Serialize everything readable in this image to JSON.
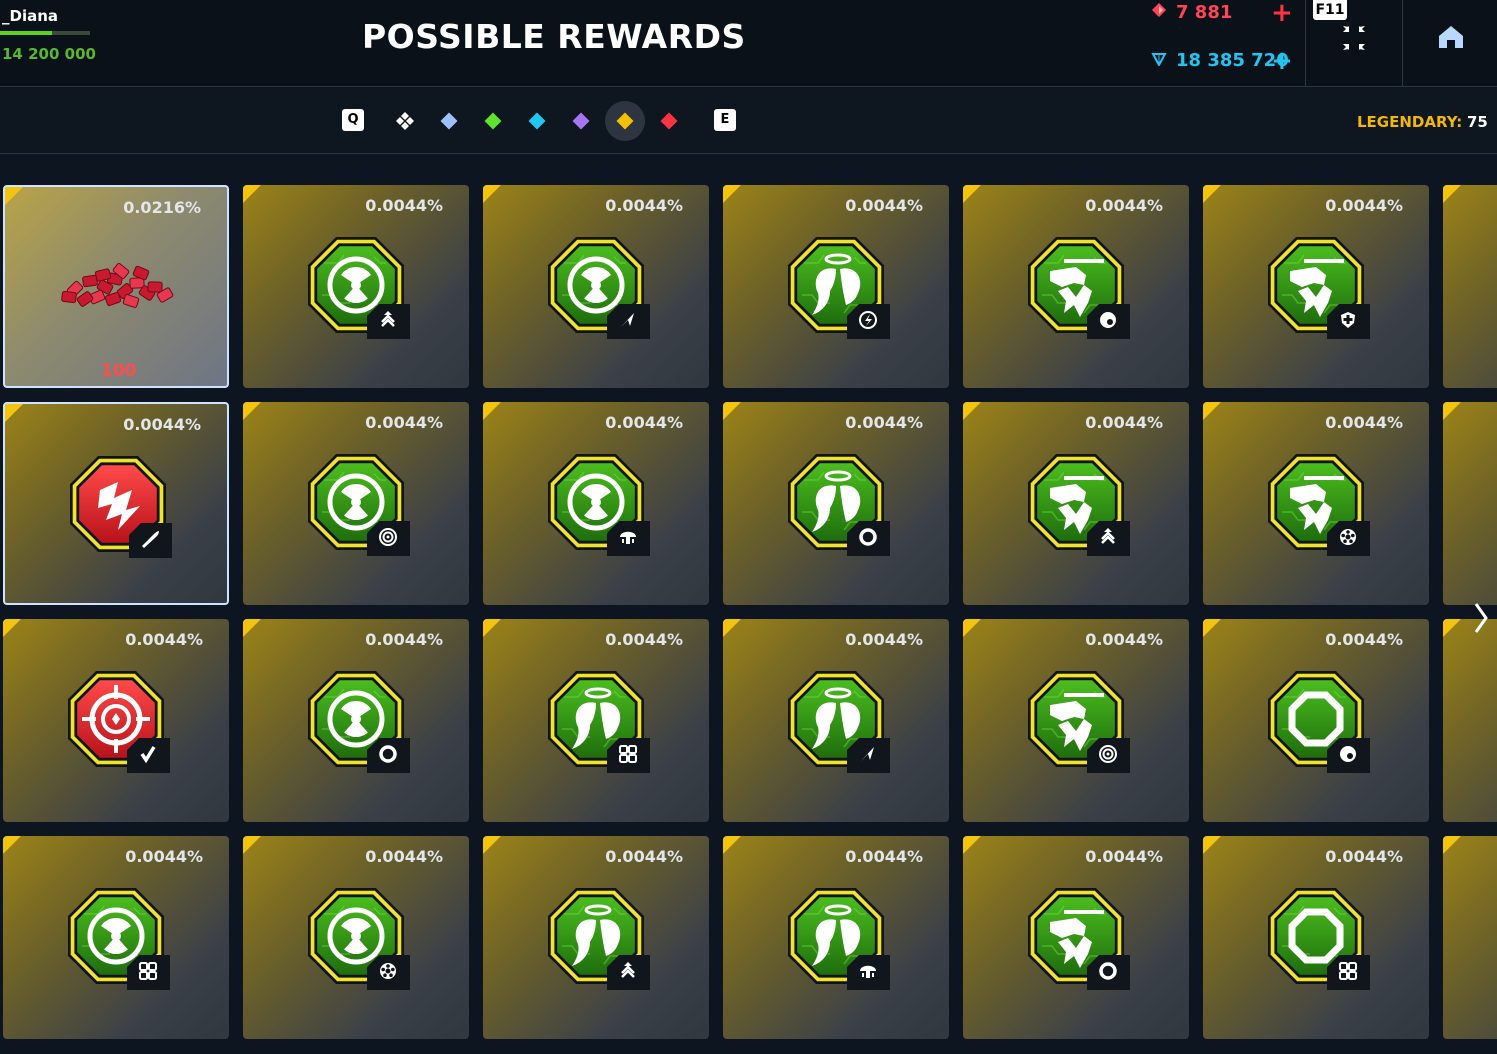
{
  "header": {
    "player_name": "_Diana",
    "player_progress": 0.58,
    "player_score": "14 200 000",
    "title": "POSSIBLE REWARDS",
    "rubies": "7 881",
    "crystals": "18 385 720",
    "fullscreen_key": "F11",
    "add_rubies_icon": "plus-icon",
    "add_crystals_icon": "plus-icon",
    "fullscreen_icon": "collapse-arrows-icon",
    "home_icon": "home-icon"
  },
  "filters": {
    "prev_key": "Q",
    "next_key": "E",
    "rarities": [
      {
        "name": "all",
        "color": "#ffffff",
        "active": false
      },
      {
        "name": "common",
        "color": "#9fc0ff",
        "active": false
      },
      {
        "name": "uncommon",
        "color": "#5ee22a",
        "active": false
      },
      {
        "name": "rare",
        "color": "#1ec8f0",
        "active": false
      },
      {
        "name": "epic",
        "color": "#a576f2",
        "active": false
      },
      {
        "name": "legendary",
        "color": "#f5c000",
        "active": true
      },
      {
        "name": "exotic",
        "color": "#ff3344",
        "active": false
      }
    ],
    "legendary_label": "LEGENDARY:",
    "legendary_count": "75"
  },
  "colors": {
    "legendary_accent": "#f2c40e",
    "ruby_red": "#ff4455",
    "crystal_blue": "#22c4ee",
    "gold": "#f5b800"
  },
  "rewards": [
    [
      {
        "prob": "0.0216%",
        "type": "rubies",
        "qty": "100"
      },
      {
        "prob": "0.0044%",
        "type": "radiation",
        "badge": "rank"
      },
      {
        "prob": "0.0044%",
        "type": "radiation",
        "badge": "dart"
      },
      {
        "prob": "0.0044%",
        "type": "angel",
        "badge": "bolt"
      },
      {
        "prob": "0.0044%",
        "type": "tank",
        "badge": "gear"
      },
      {
        "prob": "0.0044%",
        "type": "tank",
        "badge": "shield"
      }
    ],
    [
      {
        "prob": "0.0044%",
        "type": "red-bolt",
        "badge": "rocket"
      },
      {
        "prob": "0.0044%",
        "type": "radiation",
        "badge": "target"
      },
      {
        "prob": "0.0044%",
        "type": "radiation",
        "badge": "mushroom"
      },
      {
        "prob": "0.0044%",
        "type": "angel",
        "badge": "ring"
      },
      {
        "prob": "0.0044%",
        "type": "tank",
        "badge": "rank"
      },
      {
        "prob": "0.0044%",
        "type": "tank",
        "badge": "wheel"
      }
    ],
    [
      {
        "prob": "0.0044%",
        "type": "red-crosshair",
        "badge": "check"
      },
      {
        "prob": "0.0044%",
        "type": "radiation",
        "badge": "ring"
      },
      {
        "prob": "0.0044%",
        "type": "angel",
        "badge": "grid"
      },
      {
        "prob": "0.0044%",
        "type": "angel",
        "badge": "dart"
      },
      {
        "prob": "0.0044%",
        "type": "tank",
        "badge": "target"
      },
      {
        "prob": "0.0044%",
        "type": "octagon",
        "badge": "gear"
      }
    ],
    [
      {
        "prob": "0.0044%",
        "type": "radiation",
        "badge": "grid"
      },
      {
        "prob": "0.0044%",
        "type": "radiation",
        "badge": "wheel"
      },
      {
        "prob": "0.0044%",
        "type": "angel",
        "badge": "rank"
      },
      {
        "prob": "0.0044%",
        "type": "angel",
        "badge": "mushroom"
      },
      {
        "prob": "0.0044%",
        "type": "tank",
        "badge": "ring"
      },
      {
        "prob": "0.0044%",
        "type": "octagon",
        "badge": "grid"
      }
    ]
  ]
}
